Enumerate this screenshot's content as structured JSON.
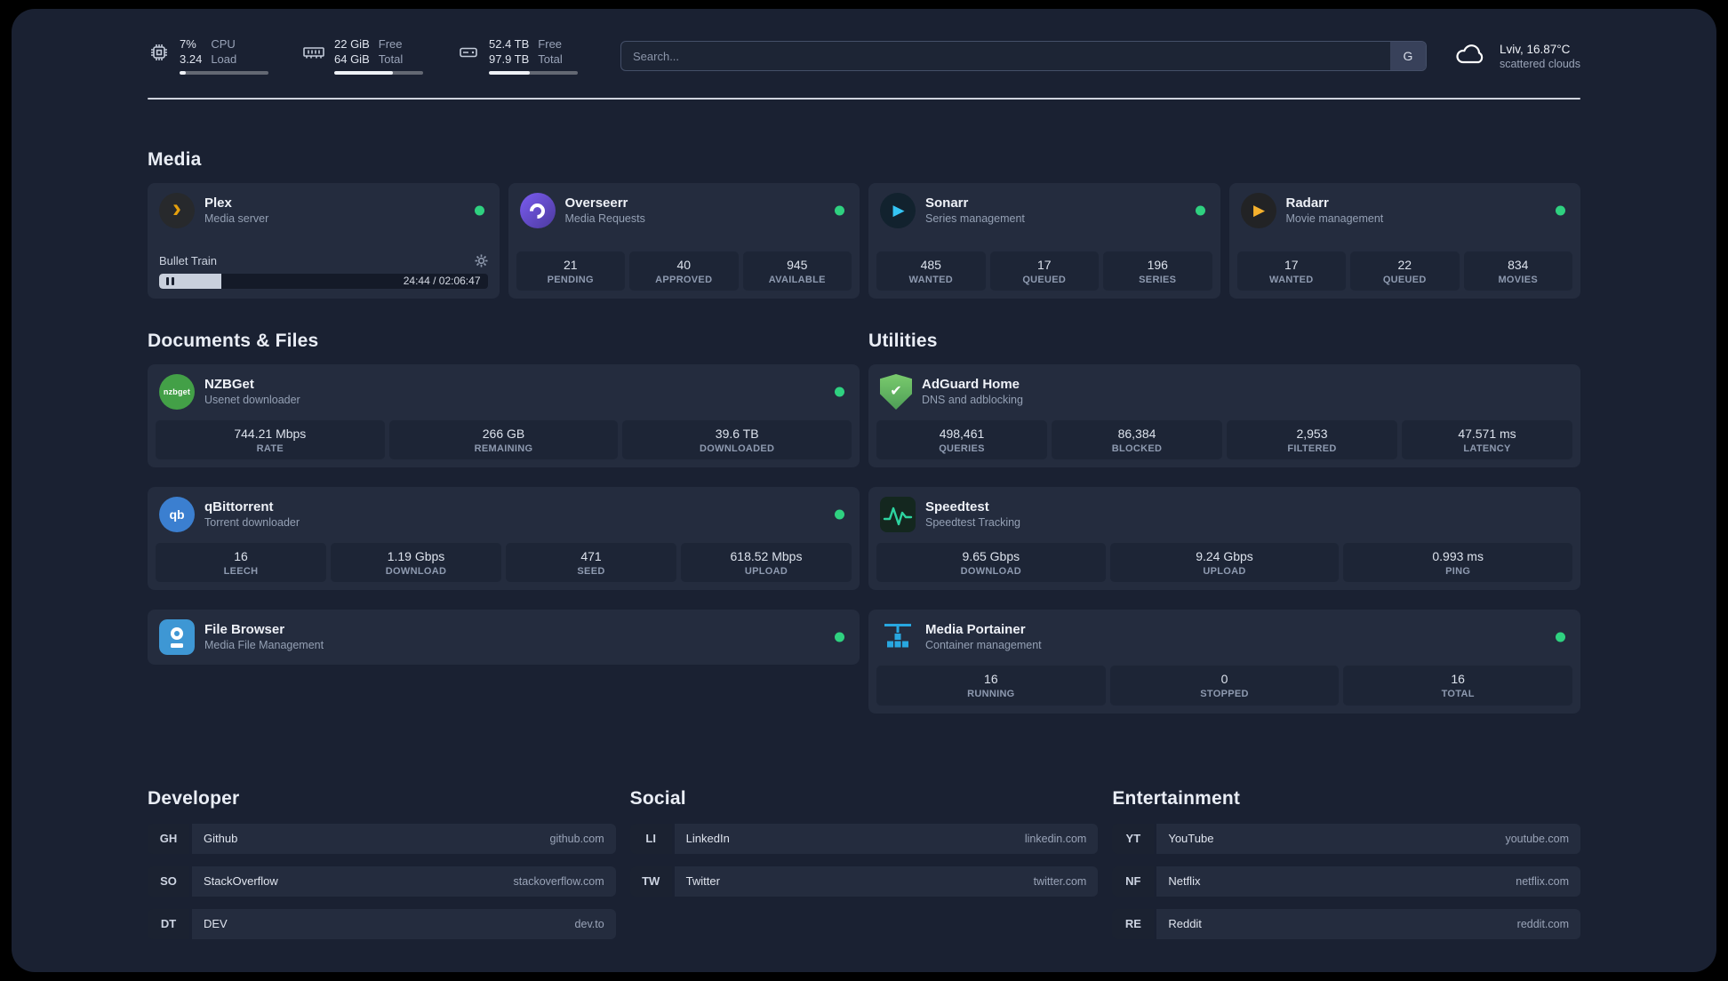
{
  "header": {
    "cpu": {
      "value_primary": "7%",
      "value_secondary": "3.24",
      "label_primary": "CPU",
      "label_secondary": "Load",
      "fill_style": "width:7%"
    },
    "ram": {
      "value_primary": "22 GiB",
      "value_secondary": "64 GiB",
      "label_primary": "Free",
      "label_secondary": "Total",
      "fill_style": "width:66%"
    },
    "disk": {
      "value_primary": "52.4 TB",
      "value_secondary": "97.9 TB",
      "label_primary": "Free",
      "label_secondary": "Total",
      "fill_style": "width:46%"
    },
    "search": {
      "placeholder": "Search...",
      "provider_label": "G"
    },
    "weather": {
      "location_temp": "Lviv, 16.87°C",
      "condition": "scattered clouds"
    }
  },
  "media": {
    "title": "Media",
    "plex": {
      "name": "Plex",
      "subtitle": "Media server",
      "now_playing": "Bullet Train",
      "time": "24:44 / 02:06:47",
      "progress_style": "width:19%"
    },
    "overseerr": {
      "name": "Overseerr",
      "subtitle": "Media Requests",
      "stats": [
        {
          "value": "21",
          "label": "PENDING"
        },
        {
          "value": "40",
          "label": "APPROVED"
        },
        {
          "value": "945",
          "label": "AVAILABLE"
        }
      ]
    },
    "sonarr": {
      "name": "Sonarr",
      "subtitle": "Series management",
      "stats": [
        {
          "value": "485",
          "label": "WANTED"
        },
        {
          "value": "17",
          "label": "QUEUED"
        },
        {
          "value": "196",
          "label": "SERIES"
        }
      ]
    },
    "radarr": {
      "name": "Radarr",
      "subtitle": "Movie management",
      "stats": [
        {
          "value": "17",
          "label": "WANTED"
        },
        {
          "value": "22",
          "label": "QUEUED"
        },
        {
          "value": "834",
          "label": "MOVIES"
        }
      ]
    }
  },
  "documents": {
    "title": "Documents & Files",
    "nzbget": {
      "name": "NZBGet",
      "subtitle": "Usenet downloader",
      "icon_text": "nzbget",
      "stats": [
        {
          "value": "744.21 Mbps",
          "label": "RATE"
        },
        {
          "value": "266 GB",
          "label": "REMAINING"
        },
        {
          "value": "39.6 TB",
          "label": "DOWNLOADED"
        }
      ]
    },
    "qbittorrent": {
      "name": "qBittorrent",
      "subtitle": "Torrent downloader",
      "icon_text": "qb",
      "stats": [
        {
          "value": "16",
          "label": "LEECH"
        },
        {
          "value": "1.19 Gbps",
          "label": "DOWNLOAD"
        },
        {
          "value": "471",
          "label": "SEED"
        },
        {
          "value": "618.52 Mbps",
          "label": "UPLOAD"
        }
      ]
    },
    "filebrowser": {
      "name": "File Browser",
      "subtitle": "Media File Management"
    }
  },
  "utilities": {
    "title": "Utilities",
    "adguard": {
      "name": "AdGuard Home",
      "subtitle": "DNS and adblocking",
      "stats": [
        {
          "value": "498,461",
          "label": "QUERIES"
        },
        {
          "value": "86,384",
          "label": "BLOCKED"
        },
        {
          "value": "2,953",
          "label": "FILTERED"
        },
        {
          "value": "47.571 ms",
          "label": "LATENCY"
        }
      ]
    },
    "speedtest": {
      "name": "Speedtest",
      "subtitle": "Speedtest Tracking",
      "stats": [
        {
          "value": "9.65 Gbps",
          "label": "DOWNLOAD"
        },
        {
          "value": "9.24 Gbps",
          "label": "UPLOAD"
        },
        {
          "value": "0.993 ms",
          "label": "PING"
        }
      ]
    },
    "portainer": {
      "name": "Media Portainer",
      "subtitle": "Container management",
      "stats": [
        {
          "value": "16",
          "label": "RUNNING"
        },
        {
          "value": "0",
          "label": "STOPPED"
        },
        {
          "value": "16",
          "label": "TOTAL"
        }
      ]
    }
  },
  "bookmarks": {
    "developer": {
      "title": "Developer",
      "items": [
        {
          "abbr": "GH",
          "name": "Github",
          "url": "github.com"
        },
        {
          "abbr": "SO",
          "name": "StackOverflow",
          "url": "stackoverflow.com"
        },
        {
          "abbr": "DT",
          "name": "DEV",
          "url": "dev.to"
        }
      ]
    },
    "social": {
      "title": "Social",
      "items": [
        {
          "abbr": "LI",
          "name": "LinkedIn",
          "url": "linkedin.com"
        },
        {
          "abbr": "TW",
          "name": "Twitter",
          "url": "twitter.com"
        }
      ]
    },
    "entertainment": {
      "title": "Entertainment",
      "items": [
        {
          "abbr": "YT",
          "name": "YouTube",
          "url": "youtube.com"
        },
        {
          "abbr": "NF",
          "name": "Netflix",
          "url": "netflix.com"
        },
        {
          "abbr": "RE",
          "name": "Reddit",
          "url": "reddit.com"
        }
      ]
    }
  },
  "icons": {
    "plex_glyph": "›",
    "sonarr_glyph": "▶",
    "radarr_glyph": "▶",
    "adguard_glyph": "✔"
  },
  "colors": {
    "status_online": "#2fd180",
    "plex": "#e5a00d",
    "overseerr": "#6a4fe0",
    "sonarr": "#35c5f4",
    "radarr": "#f5b12d",
    "nzbget": "#43a047",
    "qbittorrent": "#3b7fd0",
    "filebrowser": "#3e97d4",
    "adguard": "#5fae5e",
    "speedtest": "#2dd4a0",
    "portainer": "#28a7e0"
  }
}
